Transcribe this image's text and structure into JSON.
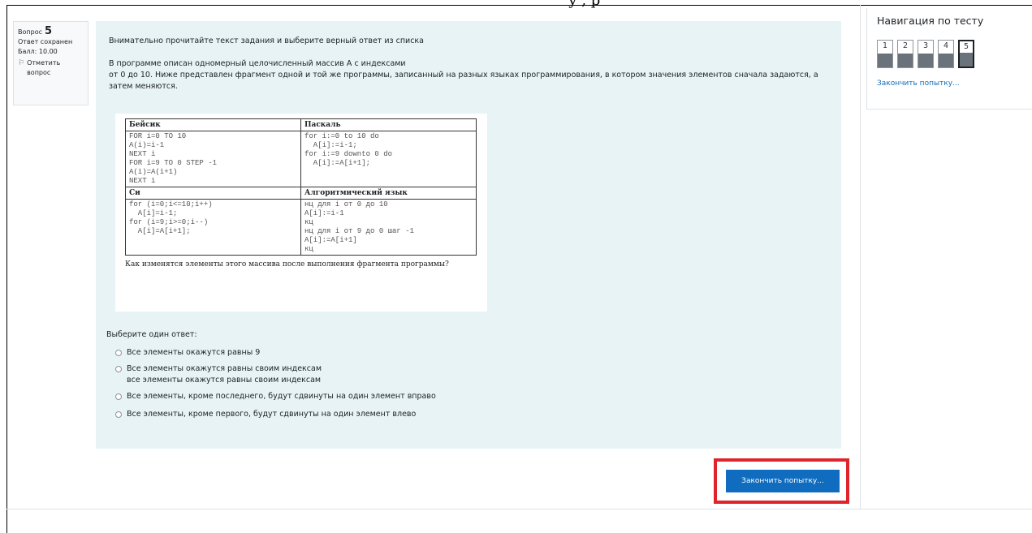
{
  "page": {
    "cut_text": "у , р"
  },
  "question_info": {
    "label": "Вопрос",
    "number": "5",
    "status": "Ответ сохранен",
    "score": "Балл: 10.00",
    "flag_label": "Отметить вопрос"
  },
  "question": {
    "instruction": "Внимательно прочитайте текст задания и выберите верный ответ из списка",
    "para_line1": "В программе описан одномерный целочисленный массив А с индексами",
    "para_line2": "от 0 до 10. Ниже представлен фрагмент одной и той же программы, записанный на разных языках программирования, в котором значения элементов сначала задаются, а затем меняются.",
    "table": {
      "h_basic": "Бейсик",
      "h_pascal": "Паскаль",
      "code_basic": "FOR i=0 TO 10\nA(i)=i-1\nNEXT i\nFOR i=9 TO 0 STEP -1\nA(i)=A(i+1)\nNEXT i",
      "code_pascal": "for i:=0 to 10 do\n  A[i]:=i-1;\nfor i:=9 downto 0 do\n  A[i]:=A[i+1];",
      "h_c": "Си",
      "h_algo": "Алгоритмический язык",
      "code_c": "for (i=0;i<=10;i++)\n  A[i]=i-1;\nfor (i=9;i>=0;i--)\n  A[i]=A[i+1];",
      "code_algo": "нц для i от 0 до 10\nA[i]:=i-1\nкц\nнц для i от 9 до 0 шаг -1\nA[i]:=A[i+1]\nкц"
    },
    "caption": "Как изменятся элементы этого массива после выполнения фрагмента программы?",
    "choose_label": "Выберите один ответ:",
    "answers": [
      "Все элементы окажутся равны 9",
      "Все элементы окажутся равны своим индексам\nвсе элементы окажутся равны своим индексам",
      "Все элементы, кроме последнего, будут сдвинуты на один элемент вправо",
      "Все элементы, кроме первого, будут сдвинуты на один элемент влево"
    ]
  },
  "submit_button": "Закончить попытку...",
  "nav": {
    "title": "Навигация по тесту",
    "buttons": [
      "1",
      "2",
      "3",
      "4",
      "5"
    ],
    "current": "5",
    "finish_link": "Закончить попытку..."
  },
  "colors": {
    "content_bg": "#e7f3f5",
    "primary": "#0f6cbf",
    "highlight": "#e0242b"
  }
}
